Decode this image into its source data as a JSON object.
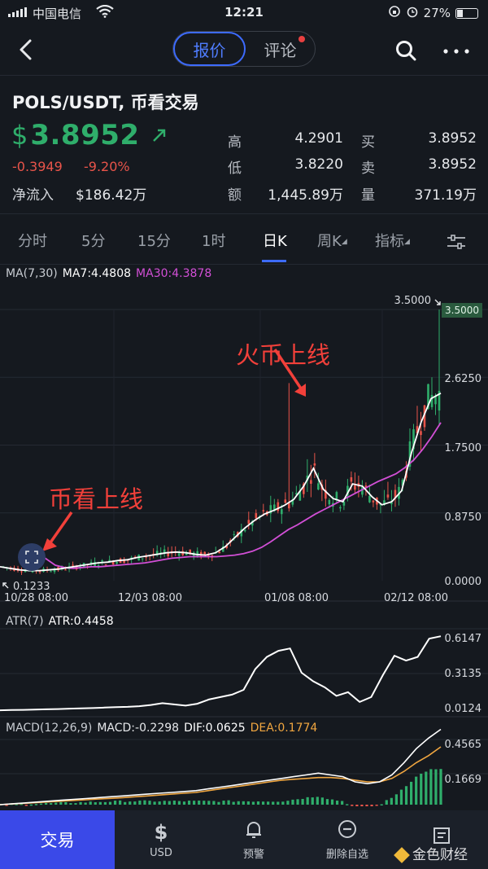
{
  "status_bar": {
    "carrier": "中国电信",
    "time": "12:21",
    "battery": "27%",
    "battery_level": 0.27
  },
  "nav": {
    "tab_quote": "报价",
    "tab_comment": "评论"
  },
  "quote": {
    "pair": "POLS/USDT, 币看交易",
    "currency_symbol": "$",
    "price": "3.8952",
    "change": "-0.3949",
    "change_pct": "-9.20%",
    "netflow_label": "净流入",
    "netflow_value": "$186.42万",
    "high_label": "高",
    "high_value": "4.2901",
    "low_label": "低",
    "low_value": "3.8220",
    "amount_label": "额",
    "amount_value": "1,445.89万",
    "buy_label": "买",
    "buy_value": "3.8952",
    "sell_label": "卖",
    "sell_value": "3.8952",
    "volume_label": "量",
    "volume_value": "371.19万"
  },
  "tabs": [
    {
      "label": "分时"
    },
    {
      "label": "5分"
    },
    {
      "label": "15分"
    },
    {
      "label": "1时"
    },
    {
      "label": "日K"
    },
    {
      "label": "周K"
    },
    {
      "label": "指标"
    }
  ],
  "indicators": {
    "ma_title": "MA(7,30)",
    "ma7": "MA7:4.4808",
    "ma30": "MA30:4.3878",
    "atr_title": "ATR(7)",
    "atr_value": "ATR:0.4458",
    "macd_title": "MACD(12,26,9)",
    "macd_value": "MACD:-0.2298",
    "dif_value": "DIF:0.0625",
    "dea_value": "DEA:0.1774"
  },
  "annotations": {
    "huobi": "火币上线",
    "bikan": "币看上线"
  },
  "colors": {
    "up": "#2fae6b",
    "down": "#e8544a",
    "ma7": "#ffffff",
    "ma30": "#d24fd6",
    "dea": "#f0a640",
    "accent": "#3d6bff"
  },
  "chart_data": [
    {
      "type": "candlestick",
      "title": "",
      "y_ticks": [
        "3.5000",
        "2.6250",
        "1.7500",
        "0.8750",
        "0.0000"
      ],
      "ylim": [
        0,
        3.5
      ],
      "x_ticks": [
        "10/28 08:00",
        "12/03 08:00",
        "01/08 08:00",
        "02/12 08:00"
      ],
      "max_label": "3.5000",
      "min_label": "0.1233",
      "last_price_tag": "3.5000",
      "series": [
        {
          "name": "MA7",
          "values": [
            0.18,
            0.16,
            0.14,
            0.13,
            0.13,
            0.14,
            0.15,
            0.17,
            0.19,
            0.21,
            0.23,
            0.24,
            0.26,
            0.27,
            0.3,
            0.32,
            0.34,
            0.36,
            0.37,
            0.36,
            0.34,
            0.33,
            0.36,
            0.44,
            0.56,
            0.68,
            0.78,
            0.86,
            0.91,
            0.97,
            1.05,
            1.22,
            1.45,
            1.18,
            1.06,
            1.02,
            1.25,
            1.22,
            1.08,
            0.98,
            1.02,
            1.16,
            1.65,
            2.05,
            2.35,
            2.42
          ]
        },
        {
          "name": "MA30",
          "values": [
            0.36,
            0.28,
            0.2,
            0.17,
            0.16,
            0.17,
            0.18,
            0.18,
            0.19,
            0.2,
            0.21,
            0.22,
            0.23,
            0.25,
            0.27,
            0.29,
            0.3,
            0.31,
            0.31,
            0.31,
            0.31,
            0.32,
            0.33,
            0.35,
            0.38,
            0.43,
            0.5,
            0.58,
            0.66,
            0.72,
            0.79,
            0.86,
            0.92,
            0.98,
            1.04,
            1.1,
            1.16,
            1.22,
            1.28,
            1.33,
            1.38,
            1.46,
            1.56,
            1.7,
            1.86,
            2.04
          ]
        }
      ]
    },
    {
      "type": "line",
      "title": "",
      "y_ticks": [
        "0.6147",
        "0.3135",
        "0.0124"
      ],
      "ylim": [
        0.0124,
        0.6147
      ],
      "series": [
        {
          "name": "ATR",
          "values": [
            0.012,
            0.014,
            0.015,
            0.017,
            0.02,
            0.022,
            0.025,
            0.028,
            0.03,
            0.034,
            0.038,
            0.04,
            0.045,
            0.055,
            0.07,
            0.06,
            0.05,
            0.065,
            0.1,
            0.12,
            0.14,
            0.18,
            0.35,
            0.45,
            0.5,
            0.52,
            0.32,
            0.25,
            0.2,
            0.13,
            0.16,
            0.08,
            0.12,
            0.3,
            0.46,
            0.42,
            0.45,
            0.6,
            0.62
          ]
        }
      ]
    },
    {
      "type": "line",
      "title": "",
      "y_ticks": [
        "0.4565",
        "0.1669"
      ],
      "series": [
        {
          "name": "DIF",
          "values": [
            0.0,
            0.005,
            0.01,
            0.015,
            0.02,
            0.025,
            0.03,
            0.035,
            0.04,
            0.045,
            0.05,
            0.055,
            0.06,
            0.065,
            0.07,
            0.075,
            0.08,
            0.09,
            0.1,
            0.11,
            0.12,
            0.13,
            0.14,
            0.15,
            0.16,
            0.17,
            0.18,
            0.17,
            0.16,
            0.13,
            0.12,
            0.13,
            0.17,
            0.24,
            0.32,
            0.38,
            0.43
          ]
        },
        {
          "name": "DEA",
          "values": [
            0.0,
            0.004,
            0.008,
            0.012,
            0.016,
            0.02,
            0.024,
            0.028,
            0.032,
            0.036,
            0.04,
            0.045,
            0.05,
            0.055,
            0.06,
            0.065,
            0.07,
            0.08,
            0.09,
            0.1,
            0.11,
            0.12,
            0.13,
            0.14,
            0.145,
            0.15,
            0.155,
            0.155,
            0.15,
            0.14,
            0.13,
            0.13,
            0.15,
            0.19,
            0.24,
            0.28,
            0.33
          ]
        }
      ]
    }
  ],
  "bottom_bar": {
    "trade": "交易",
    "usd": "USD",
    "alert": "预警",
    "remove_watch": "删除自选"
  },
  "watermark": "金色财经"
}
